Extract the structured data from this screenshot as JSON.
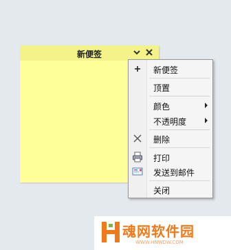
{
  "note": {
    "title": "新便签",
    "icons": {
      "collapse": "chevron-down-icon",
      "close": "close-icon"
    },
    "background": "#ffff99"
  },
  "context_menu": {
    "items": [
      {
        "label": "新便签",
        "icon": "plus-icon"
      },
      {
        "label": "顶置",
        "icon": ""
      },
      {
        "label": "颜色",
        "icon": "",
        "submenu": true
      },
      {
        "label": "不透明度",
        "icon": "",
        "submenu": true
      },
      {
        "label": "删除",
        "icon": "close-x-icon"
      },
      {
        "label": "打印",
        "icon": "printer-icon"
      },
      {
        "label": "发送到邮件",
        "icon": "email-icon"
      },
      {
        "label": "关闭",
        "icon": ""
      }
    ]
  },
  "watermark": {
    "brand": "魂网软件园",
    "url": "WWW.HNWDW.COM",
    "color": "#f07a1a"
  }
}
